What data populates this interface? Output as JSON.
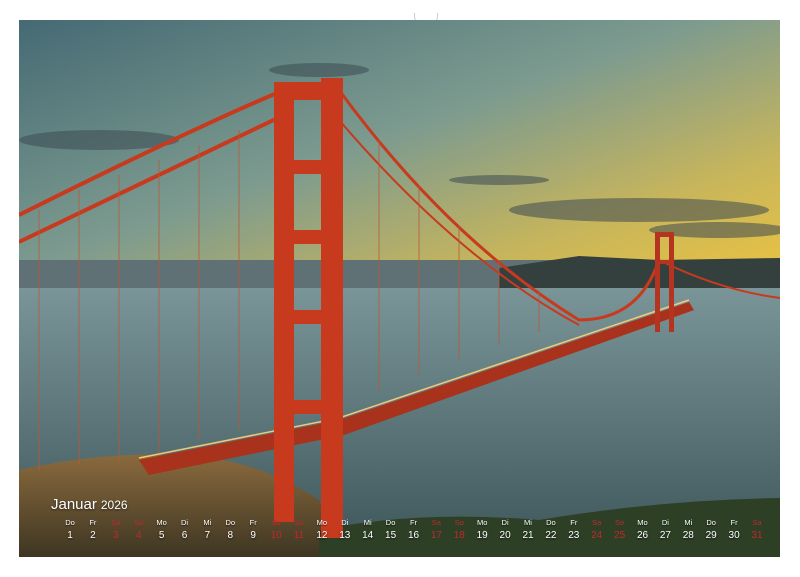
{
  "calendar": {
    "month": "Januar",
    "year": "2026",
    "days": [
      {
        "wd": "Do",
        "n": "1"
      },
      {
        "wd": "Fr",
        "n": "2"
      },
      {
        "wd": "Sa",
        "n": "3"
      },
      {
        "wd": "So",
        "n": "4"
      },
      {
        "wd": "Mo",
        "n": "5"
      },
      {
        "wd": "Di",
        "n": "6"
      },
      {
        "wd": "Mi",
        "n": "7"
      },
      {
        "wd": "Do",
        "n": "8"
      },
      {
        "wd": "Fr",
        "n": "9"
      },
      {
        "wd": "Sa",
        "n": "10"
      },
      {
        "wd": "So",
        "n": "11"
      },
      {
        "wd": "Mo",
        "n": "12"
      },
      {
        "wd": "Di",
        "n": "13"
      },
      {
        "wd": "Mi",
        "n": "14"
      },
      {
        "wd": "Do",
        "n": "15"
      },
      {
        "wd": "Fr",
        "n": "16"
      },
      {
        "wd": "Sa",
        "n": "17"
      },
      {
        "wd": "So",
        "n": "18"
      },
      {
        "wd": "Mo",
        "n": "19"
      },
      {
        "wd": "Di",
        "n": "20"
      },
      {
        "wd": "Mi",
        "n": "21"
      },
      {
        "wd": "Do",
        "n": "22"
      },
      {
        "wd": "Fr",
        "n": "23"
      },
      {
        "wd": "Sa",
        "n": "24"
      },
      {
        "wd": "So",
        "n": "25"
      },
      {
        "wd": "Mo",
        "n": "26"
      },
      {
        "wd": "Di",
        "n": "27"
      },
      {
        "wd": "Mi",
        "n": "28"
      },
      {
        "wd": "Do",
        "n": "29"
      },
      {
        "wd": "Fr",
        "n": "30"
      },
      {
        "wd": "Sa",
        "n": "31"
      }
    ]
  },
  "colors": {
    "bridge": "#c73a1e",
    "weekend": "#c1272d",
    "sky_top": "#4e7480",
    "sunset": "#e8c451",
    "water": "#5b7a80"
  }
}
